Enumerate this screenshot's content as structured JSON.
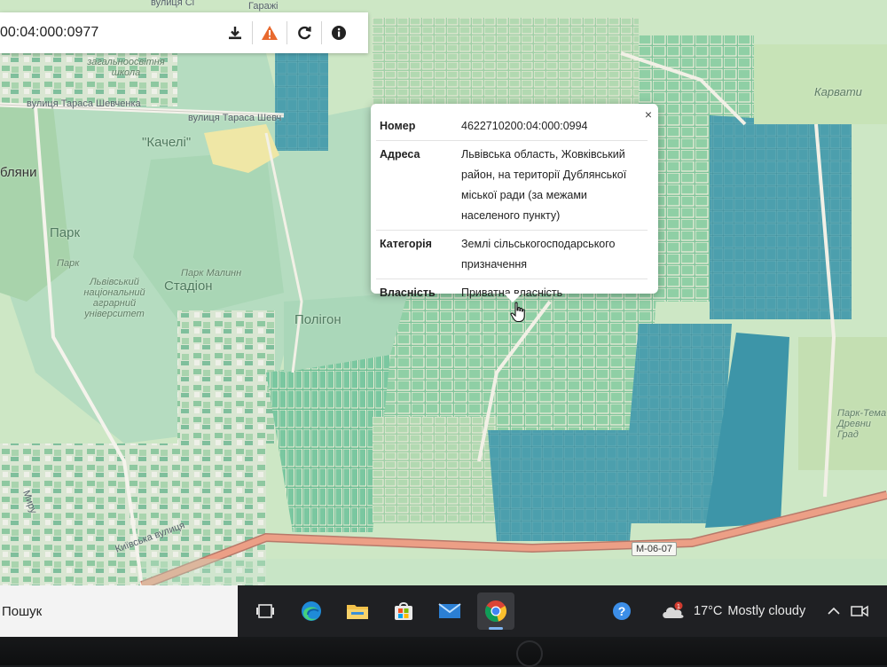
{
  "toolbar": {
    "cadastral_number": "00:04:000:0977",
    "download_icon": "download-icon",
    "warning_icon": "warning-icon",
    "refresh_icon": "refresh-icon",
    "info_icon": "info-icon"
  },
  "map_labels": {
    "street_top": "вулиця Сі",
    "garages": "Гаражі",
    "school": "загальноосвітня школа",
    "street_shevchenka_1": "вулиця Тараса Шевченка",
    "street_shevchenka_2": "вулиця Тараса Шевч",
    "kacheli": "\"Качелі\"",
    "dublyany": "бляни",
    "park": "Парк",
    "park_small": "Парк",
    "university": "Львівський національний аграрний університет",
    "stadium_park": "Парк Малинн",
    "stadium": "Стадіон",
    "polygon": "Полігон",
    "karvaty": "Карвати",
    "park_ancient": "Парк-Тема Древни Град",
    "kyivska": "Київська вулиця",
    "myr": "Миру",
    "road_shield": "М-06-07"
  },
  "popup": {
    "close_label": "×",
    "rows": [
      {
        "key": "Номер",
        "value": "4622710200:04:000:0994"
      },
      {
        "key": "Адреса",
        "value": "Львівська область, Жовківський район, на території Дублянської міської ради (за межами населеного пункту)"
      },
      {
        "key": "Категорія",
        "value": "Землі сільськогосподарського призначення"
      },
      {
        "key": "Власність",
        "value": "Приватна власність"
      }
    ]
  },
  "taskbar": {
    "search_text": "Пошук",
    "apps": [
      "task-view",
      "edge",
      "file-explorer",
      "microsoft-store",
      "mail",
      "chrome"
    ],
    "active_app": "chrome",
    "weather_temp": "17°C",
    "weather_desc": "Mostly cloudy",
    "weather_badge": "1"
  },
  "colors": {
    "warning": "#e8692e",
    "map_green": "#cfe6c4",
    "parcel_green": "#86c79d",
    "parcel_blue": "#4a9aa8",
    "road": "#e9a48a"
  }
}
